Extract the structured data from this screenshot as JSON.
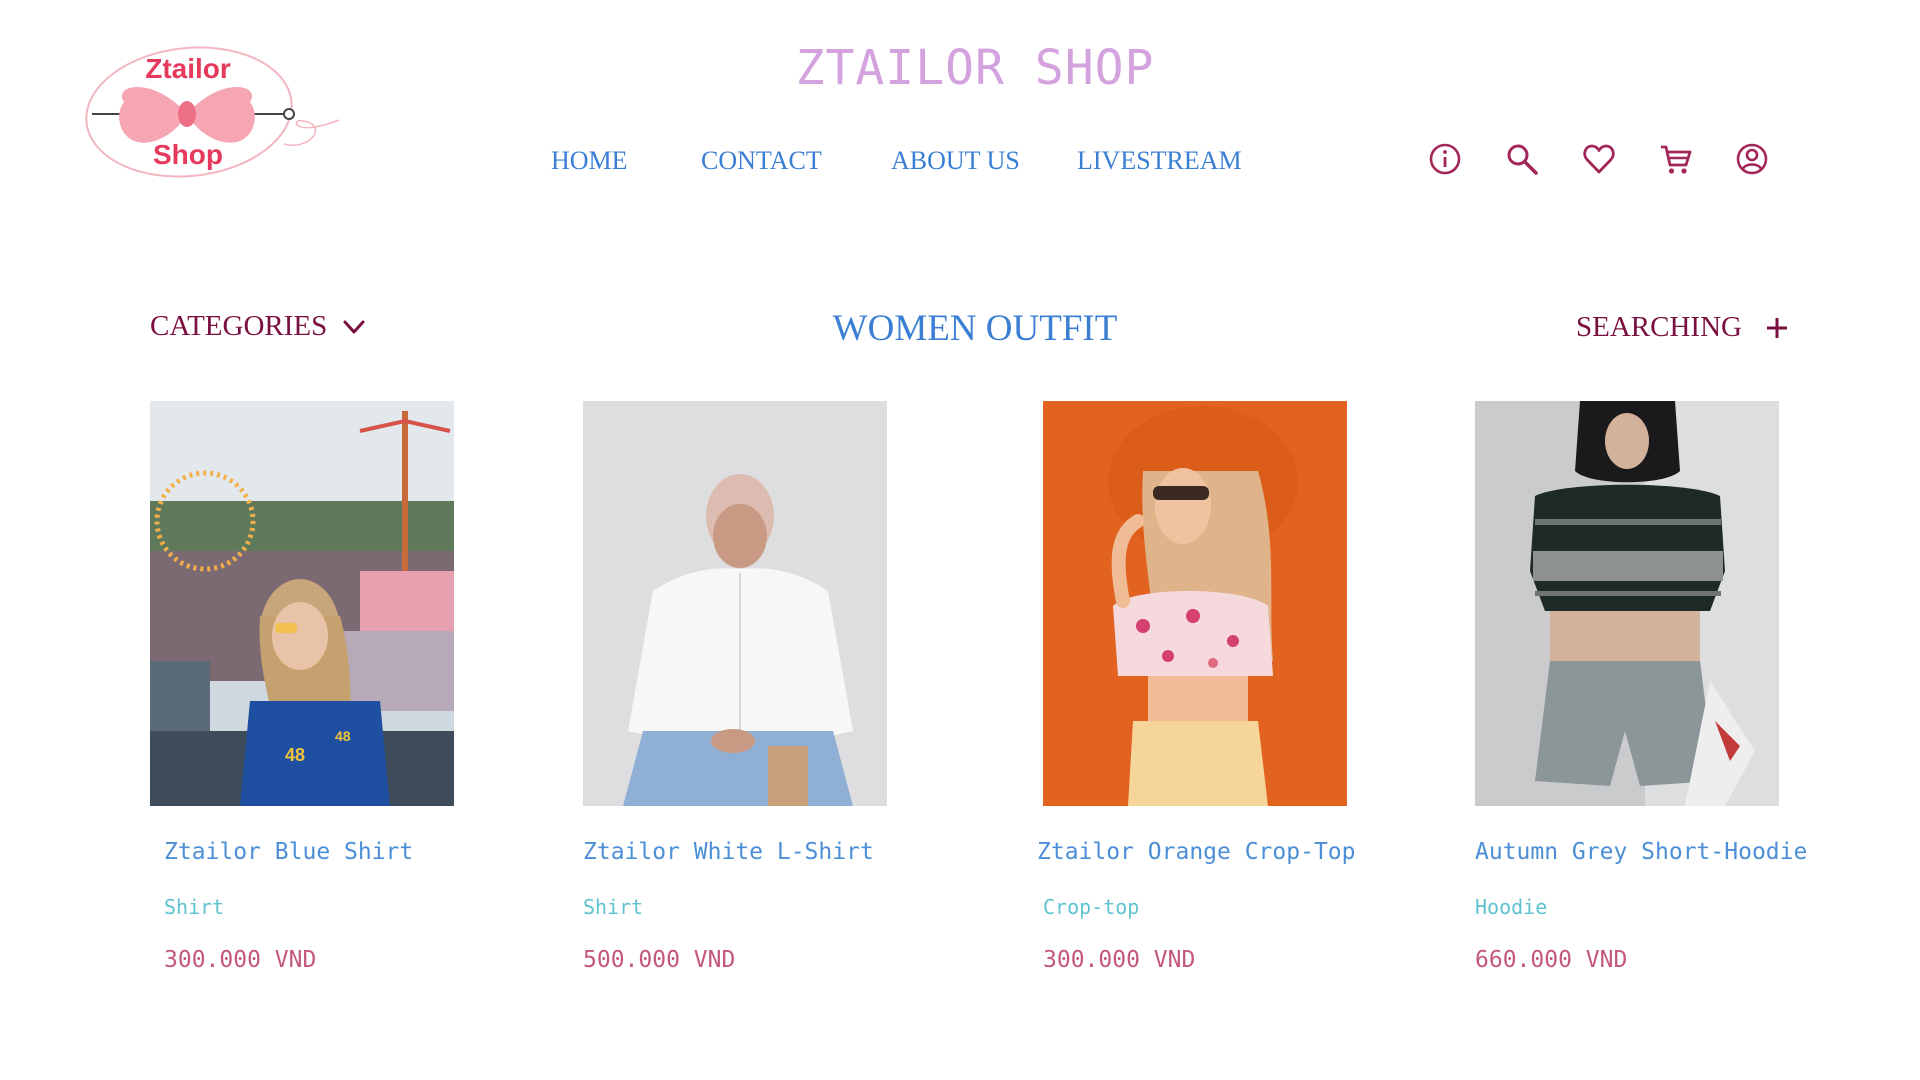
{
  "brand": {
    "logo_text_top": "Ztailor",
    "logo_text_bottom": "Shop",
    "site_title": "ZTAILOR SHOP"
  },
  "nav": {
    "items": [
      {
        "label": "HOME"
      },
      {
        "label": "CONTACT"
      },
      {
        "label": "ABOUT US"
      },
      {
        "label": "LIVESTREAM"
      }
    ]
  },
  "header_icons": [
    "info-icon",
    "search-icon",
    "heart-icon",
    "cart-icon",
    "user-icon"
  ],
  "toolbar": {
    "categories_label": "CATEGORIES",
    "section_title": "WOMEN OUTFIT",
    "searching_label": "SEARCHING"
  },
  "products": [
    {
      "name": "Ztailor Blue Shirt",
      "category": "Shirt",
      "price": "300.000 VND"
    },
    {
      "name": "Ztailor White L-Shirt",
      "category": "Shirt",
      "price": "500.000 VND"
    },
    {
      "name": "Ztailor Orange Crop-Top",
      "category": "Crop-top",
      "price": "300.000 VND"
    },
    {
      "name": "Autumn Grey Short-Hoodie",
      "category": "Hoodie",
      "price": "660.000 VND"
    }
  ],
  "colors": {
    "title": "#d3a2df",
    "nav": "#3b7fd4",
    "icons": "#a3285a",
    "toolbar": "#7a1040",
    "product_name": "#4c8fd6",
    "product_category": "#5fc3cf",
    "price": "#c4577f",
    "logo_pink": "#f6a6b2",
    "logo_text": "#e63a5c"
  }
}
